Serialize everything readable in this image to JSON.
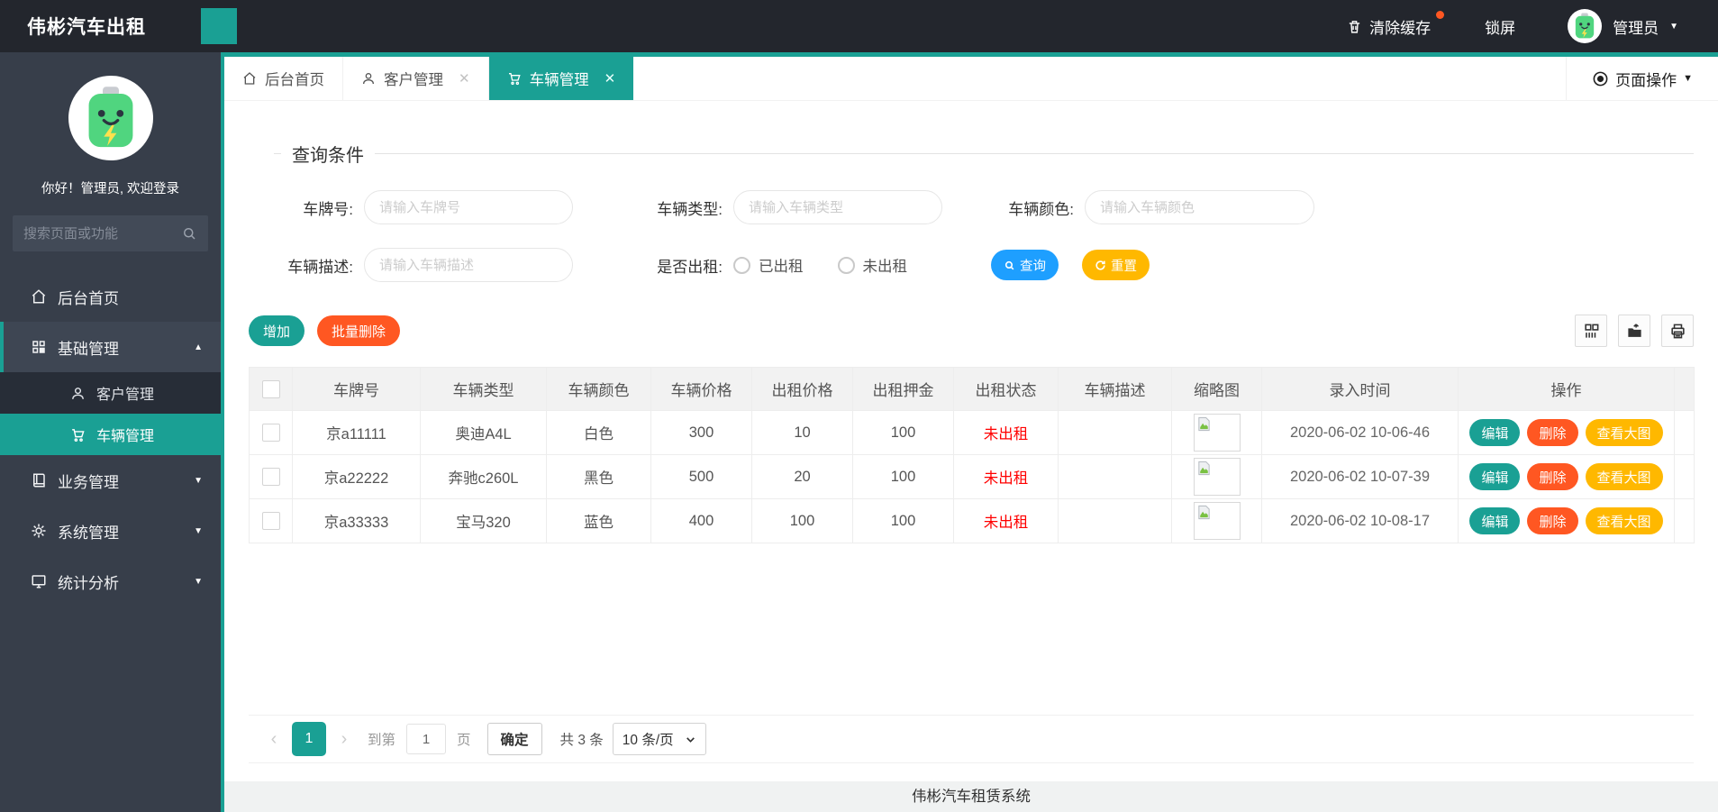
{
  "colors": {
    "accent": "#1aa094",
    "blue": "#1e9fff",
    "orange": "#ffb800",
    "danger": "#ff5722",
    "status_red": "#ff0000"
  },
  "header": {
    "brand": "伟彬汽车出租",
    "clear_cache": "清除缓存",
    "lock": "锁屏",
    "user": "管理员"
  },
  "sidebar": {
    "greeting": "你好！管理员, 欢迎登录",
    "search_placeholder": "搜索页面或功能",
    "items": [
      {
        "label": "后台首页",
        "icon": "home-icon"
      },
      {
        "label": "基础管理",
        "icon": "grid-icon",
        "state": "expanded"
      },
      {
        "label": "客户管理",
        "icon": "user-icon",
        "state": "child"
      },
      {
        "label": "车辆管理",
        "icon": "cart-icon",
        "state": "child-active"
      },
      {
        "label": "业务管理",
        "icon": "book-icon"
      },
      {
        "label": "系统管理",
        "icon": "gear-icon"
      },
      {
        "label": "统计分析",
        "icon": "monitor-icon"
      }
    ]
  },
  "tabs": [
    {
      "label": "后台首页",
      "icon": "home-icon",
      "closable": false,
      "active": false
    },
    {
      "label": "客户管理",
      "icon": "user-icon",
      "closable": true,
      "active": false
    },
    {
      "label": "车辆管理",
      "icon": "cart-icon",
      "closable": true,
      "active": true
    }
  ],
  "page_ops": "页面操作",
  "query": {
    "legend": "查询条件",
    "plate_label": "车牌号:",
    "plate_placeholder": "请输入车牌号",
    "type_label": "车辆类型:",
    "type_placeholder": "请输入车辆类型",
    "color_label": "车辆颜色:",
    "color_placeholder": "请输入车辆颜色",
    "desc_label": "车辆描述:",
    "desc_placeholder": "请输入车辆描述",
    "rent_label": "是否出租:",
    "radio_rented": "已出租",
    "radio_available": "未出租",
    "search": "查询",
    "reset": "重置"
  },
  "toolbar": {
    "add": "增加",
    "batch_delete": "批量删除"
  },
  "table": {
    "headers": [
      "车牌号",
      "车辆类型",
      "车辆颜色",
      "车辆价格",
      "出租价格",
      "出租押金",
      "出租状态",
      "车辆描述",
      "缩略图",
      "录入时间",
      "操作"
    ],
    "rows": [
      {
        "plate": "京a11111",
        "type": "奥迪A4L",
        "color": "白色",
        "price": "300",
        "rent": "10",
        "deposit": "100",
        "status": "未出租",
        "desc": "",
        "time": "2020-06-02 10-06-46"
      },
      {
        "plate": "京a22222",
        "type": "奔驰c260L",
        "color": "黑色",
        "price": "500",
        "rent": "20",
        "deposit": "100",
        "status": "未出租",
        "desc": "",
        "time": "2020-06-02 10-07-39"
      },
      {
        "plate": "京a33333",
        "type": "宝马320",
        "color": "蓝色",
        "price": "400",
        "rent": "100",
        "deposit": "100",
        "status": "未出租",
        "desc": "",
        "time": "2020-06-02 10-08-17"
      }
    ],
    "actions": {
      "edit": "编辑",
      "del": "删除",
      "view": "查看大图"
    }
  },
  "pagination": {
    "current": "1",
    "goto_label": "到第",
    "page_input": "1",
    "page_label": "页",
    "confirm": "确定",
    "total": "共 3 条",
    "page_size": "10 条/页"
  },
  "footer": "伟彬汽车租赁系统"
}
